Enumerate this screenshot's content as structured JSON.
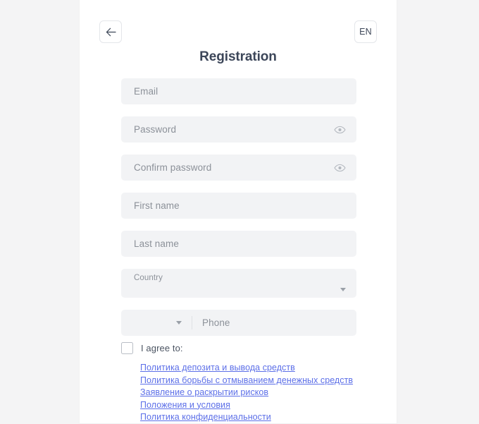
{
  "header": {
    "back_icon": "arrow-left-icon",
    "language_label": "EN",
    "title": "Registration"
  },
  "form": {
    "fields": [
      {
        "name": "email",
        "placeholder": "Email",
        "icon": ""
      },
      {
        "name": "password",
        "placeholder": "Password",
        "icon": "eye-icon"
      },
      {
        "name": "confirm-password",
        "placeholder": "Confirm password",
        "icon": "eye-icon"
      },
      {
        "name": "first-name",
        "placeholder": "First name",
        "icon": ""
      },
      {
        "name": "last-name",
        "placeholder": "Last name",
        "icon": ""
      }
    ],
    "country": {
      "label": "Country",
      "value": "",
      "caret_icon": "chevron-down-icon"
    },
    "phone": {
      "country_code_value": "",
      "caret_icon": "chevron-down-icon",
      "placeholder": "Phone"
    }
  },
  "agreement": {
    "checked": false,
    "label": "I agree to:",
    "links": [
      "Политика депозита и вывода средств",
      "Политика борьбы с отмыванием денежных средств",
      "Заявление о раскрытии рисков",
      "Положения и условия",
      "Политика конфиденциальности"
    ]
  },
  "colors": {
    "page_background": "#f4f4f5",
    "card_background": "#ffffff",
    "field_background": "#f2f3f5",
    "placeholder_text": "#8c9199",
    "title_text": "#3c4659",
    "link": "#5c6fe8",
    "checkbox_border": "#b9bec6",
    "button_border": "#e4e6ea"
  }
}
